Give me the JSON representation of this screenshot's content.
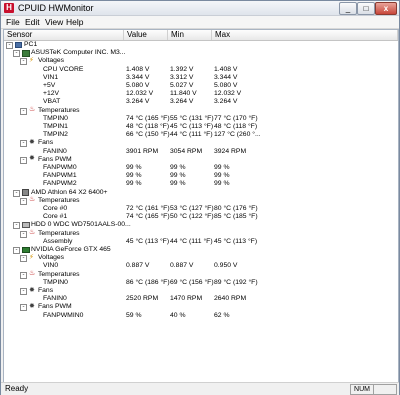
{
  "window": {
    "title": "CPUID HWMonitor",
    "icon_letter": "H",
    "close_glyph": "x",
    "min_glyph": "_",
    "max_glyph": "□"
  },
  "menu": [
    "File",
    "Edit",
    "View",
    "Help"
  ],
  "columns": [
    "Sensor",
    "Value",
    "Min",
    "Max"
  ],
  "status": {
    "text": "Ready",
    "num": "NUM"
  },
  "rows": [
    {
      "level": 0,
      "toggle": "-",
      "icon": "pc",
      "label": "PC1",
      "value": "",
      "min": "",
      "max": ""
    },
    {
      "level": 1,
      "toggle": "-",
      "icon": "board",
      "label": "ASUSTeK Computer INC. M3...",
      "value": "",
      "min": "",
      "max": ""
    },
    {
      "level": 2,
      "toggle": "-",
      "icon": "volt",
      "label": "Voltages",
      "value": "",
      "min": "",
      "max": ""
    },
    {
      "level": 3,
      "toggle": "",
      "icon": "",
      "label": "CPU VCORE",
      "value": "1.408 V",
      "min": "1.392 V",
      "max": "1.408 V"
    },
    {
      "level": 3,
      "toggle": "",
      "icon": "",
      "label": "VIN1",
      "value": "3.344 V",
      "min": "3.312 V",
      "max": "3.344 V"
    },
    {
      "level": 3,
      "toggle": "",
      "icon": "",
      "label": "+5V",
      "value": "5.080 V",
      "min": "5.027 V",
      "max": "5.080 V"
    },
    {
      "level": 3,
      "toggle": "",
      "icon": "",
      "label": "+12V",
      "value": "12.032 V",
      "min": "11.840 V",
      "max": "12.032 V"
    },
    {
      "level": 3,
      "toggle": "",
      "icon": "",
      "label": "VBAT",
      "value": "3.264 V",
      "min": "3.264 V",
      "max": "3.264 V"
    },
    {
      "level": 2,
      "toggle": "-",
      "icon": "temp",
      "label": "Temperatures",
      "value": "",
      "min": "",
      "max": ""
    },
    {
      "level": 3,
      "toggle": "",
      "icon": "",
      "label": "TMPIN0",
      "value": "74 °C  (165 °F)",
      "min": "55 °C  (131 °F)",
      "max": "77 °C  (170 °F)"
    },
    {
      "level": 3,
      "toggle": "",
      "icon": "",
      "label": "TMPIN1",
      "value": "48 °C  (118 °F)",
      "min": "45 °C  (113 °F)",
      "max": "48 °C  (118 °F)"
    },
    {
      "level": 3,
      "toggle": "",
      "icon": "",
      "label": "TMPIN2",
      "value": "66 °C  (150 °F)",
      "min": "44 °C  (111 °F)",
      "max": "127 °C  (260 °..."
    },
    {
      "level": 2,
      "toggle": "-",
      "icon": "fan",
      "label": "Fans",
      "value": "",
      "min": "",
      "max": ""
    },
    {
      "level": 3,
      "toggle": "",
      "icon": "",
      "label": "FANIN0",
      "value": "3901 RPM",
      "min": "3054 RPM",
      "max": "3924 RPM"
    },
    {
      "level": 2,
      "toggle": "-",
      "icon": "fan",
      "label": "Fans PWM",
      "value": "",
      "min": "",
      "max": ""
    },
    {
      "level": 3,
      "toggle": "",
      "icon": "",
      "label": "FANPWM0",
      "value": "99 %",
      "min": "99 %",
      "max": "99 %"
    },
    {
      "level": 3,
      "toggle": "",
      "icon": "",
      "label": "FANPWM1",
      "value": "99 %",
      "min": "99 %",
      "max": "99 %"
    },
    {
      "level": 3,
      "toggle": "",
      "icon": "",
      "label": "FANPWM2",
      "value": "99 %",
      "min": "99 %",
      "max": "99 %"
    },
    {
      "level": 1,
      "toggle": "-",
      "icon": "cpu",
      "label": "AMD Athlon 64 X2 6400+",
      "value": "",
      "min": "",
      "max": ""
    },
    {
      "level": 2,
      "toggle": "-",
      "icon": "temp",
      "label": "Temperatures",
      "value": "",
      "min": "",
      "max": ""
    },
    {
      "level": 3,
      "toggle": "",
      "icon": "",
      "label": "Core #0",
      "value": "72 °C  (161 °F)",
      "min": "53 °C  (127 °F)",
      "max": "80 °C  (176 °F)"
    },
    {
      "level": 3,
      "toggle": "",
      "icon": "",
      "label": "Core #1",
      "value": "74 °C  (165 °F)",
      "min": "50 °C  (122 °F)",
      "max": "85 °C  (185 °F)"
    },
    {
      "level": 1,
      "toggle": "-",
      "icon": "hdd",
      "label": "HDD 0 WDC WD7501AALS-00...",
      "value": "",
      "min": "",
      "max": ""
    },
    {
      "level": 2,
      "toggle": "-",
      "icon": "temp",
      "label": "Temperatures",
      "value": "",
      "min": "",
      "max": ""
    },
    {
      "level": 3,
      "toggle": "",
      "icon": "",
      "label": "Assembly",
      "value": "45 °C  (113 °F)",
      "min": "44 °C  (111 °F)",
      "max": "45 °C  (113 °F)"
    },
    {
      "level": 1,
      "toggle": "-",
      "icon": "gpu",
      "label": "NVIDIA GeForce GTX 465",
      "value": "",
      "min": "",
      "max": ""
    },
    {
      "level": 2,
      "toggle": "-",
      "icon": "volt",
      "label": "Voltages",
      "value": "",
      "min": "",
      "max": ""
    },
    {
      "level": 3,
      "toggle": "",
      "icon": "",
      "label": "VIN0",
      "value": "0.887 V",
      "min": "0.887 V",
      "max": "0.950 V"
    },
    {
      "level": 2,
      "toggle": "-",
      "icon": "temp",
      "label": "Temperatures",
      "value": "",
      "min": "",
      "max": ""
    },
    {
      "level": 3,
      "toggle": "",
      "icon": "",
      "label": "TMPIN0",
      "value": "86 °C  (186 °F)",
      "min": "69 °C  (156 °F)",
      "max": "89 °C  (192 °F)"
    },
    {
      "level": 2,
      "toggle": "-",
      "icon": "fan",
      "label": "Fans",
      "value": "",
      "min": "",
      "max": ""
    },
    {
      "level": 3,
      "toggle": "",
      "icon": "",
      "label": "FANIN0",
      "value": "2520 RPM",
      "min": "1470 RPM",
      "max": "2640 RPM"
    },
    {
      "level": 2,
      "toggle": "-",
      "icon": "fan",
      "label": "Fans PWM",
      "value": "",
      "min": "",
      "max": ""
    },
    {
      "level": 3,
      "toggle": "",
      "icon": "",
      "label": "FANPWMIN0",
      "value": "59 %",
      "min": "40 %",
      "max": "62 %"
    }
  ]
}
